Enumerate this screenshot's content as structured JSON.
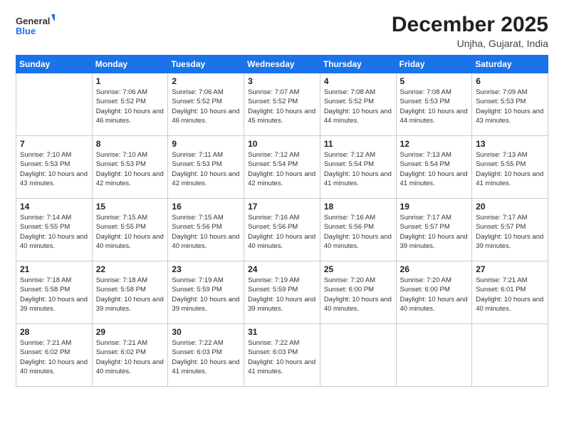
{
  "header": {
    "logo_line1": "General",
    "logo_line2": "Blue",
    "month": "December 2025",
    "location": "Unjha, Gujarat, India"
  },
  "weekdays": [
    "Sunday",
    "Monday",
    "Tuesday",
    "Wednesday",
    "Thursday",
    "Friday",
    "Saturday"
  ],
  "weeks": [
    [
      {
        "day": null
      },
      {
        "day": "1",
        "sunrise": "7:06 AM",
        "sunset": "5:52 PM",
        "daylight": "10 hours and 46 minutes."
      },
      {
        "day": "2",
        "sunrise": "7:06 AM",
        "sunset": "5:52 PM",
        "daylight": "10 hours and 46 minutes."
      },
      {
        "day": "3",
        "sunrise": "7:07 AM",
        "sunset": "5:52 PM",
        "daylight": "10 hours and 45 minutes."
      },
      {
        "day": "4",
        "sunrise": "7:08 AM",
        "sunset": "5:52 PM",
        "daylight": "10 hours and 44 minutes."
      },
      {
        "day": "5",
        "sunrise": "7:08 AM",
        "sunset": "5:53 PM",
        "daylight": "10 hours and 44 minutes."
      },
      {
        "day": "6",
        "sunrise": "7:09 AM",
        "sunset": "5:53 PM",
        "daylight": "10 hours and 43 minutes."
      }
    ],
    [
      {
        "day": "7",
        "sunrise": "7:10 AM",
        "sunset": "5:53 PM",
        "daylight": "10 hours and 43 minutes."
      },
      {
        "day": "8",
        "sunrise": "7:10 AM",
        "sunset": "5:53 PM",
        "daylight": "10 hours and 42 minutes."
      },
      {
        "day": "9",
        "sunrise": "7:11 AM",
        "sunset": "5:53 PM",
        "daylight": "10 hours and 42 minutes."
      },
      {
        "day": "10",
        "sunrise": "7:12 AM",
        "sunset": "5:54 PM",
        "daylight": "10 hours and 42 minutes."
      },
      {
        "day": "11",
        "sunrise": "7:12 AM",
        "sunset": "5:54 PM",
        "daylight": "10 hours and 41 minutes."
      },
      {
        "day": "12",
        "sunrise": "7:13 AM",
        "sunset": "5:54 PM",
        "daylight": "10 hours and 41 minutes."
      },
      {
        "day": "13",
        "sunrise": "7:13 AM",
        "sunset": "5:55 PM",
        "daylight": "10 hours and 41 minutes."
      }
    ],
    [
      {
        "day": "14",
        "sunrise": "7:14 AM",
        "sunset": "5:55 PM",
        "daylight": "10 hours and 40 minutes."
      },
      {
        "day": "15",
        "sunrise": "7:15 AM",
        "sunset": "5:55 PM",
        "daylight": "10 hours and 40 minutes."
      },
      {
        "day": "16",
        "sunrise": "7:15 AM",
        "sunset": "5:56 PM",
        "daylight": "10 hours and 40 minutes."
      },
      {
        "day": "17",
        "sunrise": "7:16 AM",
        "sunset": "5:56 PM",
        "daylight": "10 hours and 40 minutes."
      },
      {
        "day": "18",
        "sunrise": "7:16 AM",
        "sunset": "5:56 PM",
        "daylight": "10 hours and 40 minutes."
      },
      {
        "day": "19",
        "sunrise": "7:17 AM",
        "sunset": "5:57 PM",
        "daylight": "10 hours and 39 minutes."
      },
      {
        "day": "20",
        "sunrise": "7:17 AM",
        "sunset": "5:57 PM",
        "daylight": "10 hours and 39 minutes."
      }
    ],
    [
      {
        "day": "21",
        "sunrise": "7:18 AM",
        "sunset": "5:58 PM",
        "daylight": "10 hours and 39 minutes."
      },
      {
        "day": "22",
        "sunrise": "7:18 AM",
        "sunset": "5:58 PM",
        "daylight": "10 hours and 39 minutes."
      },
      {
        "day": "23",
        "sunrise": "7:19 AM",
        "sunset": "5:59 PM",
        "daylight": "10 hours and 39 minutes."
      },
      {
        "day": "24",
        "sunrise": "7:19 AM",
        "sunset": "5:59 PM",
        "daylight": "10 hours and 39 minutes."
      },
      {
        "day": "25",
        "sunrise": "7:20 AM",
        "sunset": "6:00 PM",
        "daylight": "10 hours and 40 minutes."
      },
      {
        "day": "26",
        "sunrise": "7:20 AM",
        "sunset": "6:00 PM",
        "daylight": "10 hours and 40 minutes."
      },
      {
        "day": "27",
        "sunrise": "7:21 AM",
        "sunset": "6:01 PM",
        "daylight": "10 hours and 40 minutes."
      }
    ],
    [
      {
        "day": "28",
        "sunrise": "7:21 AM",
        "sunset": "6:02 PM",
        "daylight": "10 hours and 40 minutes."
      },
      {
        "day": "29",
        "sunrise": "7:21 AM",
        "sunset": "6:02 PM",
        "daylight": "10 hours and 40 minutes."
      },
      {
        "day": "30",
        "sunrise": "7:22 AM",
        "sunset": "6:03 PM",
        "daylight": "10 hours and 41 minutes."
      },
      {
        "day": "31",
        "sunrise": "7:22 AM",
        "sunset": "6:03 PM",
        "daylight": "10 hours and 41 minutes."
      },
      {
        "day": null
      },
      {
        "day": null
      },
      {
        "day": null
      }
    ]
  ]
}
